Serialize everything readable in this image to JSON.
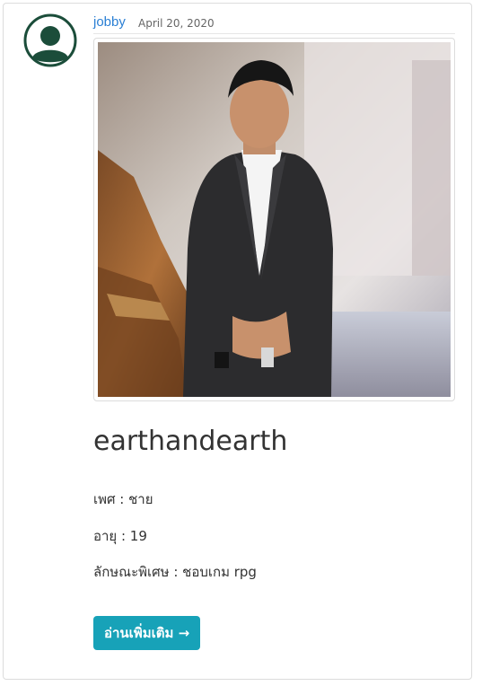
{
  "post": {
    "author": "jobby",
    "date": "April 20, 2020",
    "title": "earthandearth",
    "details": {
      "gender": "เพศ : ชาย",
      "age": "อายุ : 19",
      "trait": "ลักษณะพิเศษ : ชอบเกม rpg"
    },
    "read_more_label": "อ่านเพิ่มเติม →"
  },
  "icons": {
    "avatar": "user-avatar-icon"
  },
  "colors": {
    "link": "#2a7fd4",
    "button": "#17a2b8",
    "avatar": "#1b4d3a"
  }
}
